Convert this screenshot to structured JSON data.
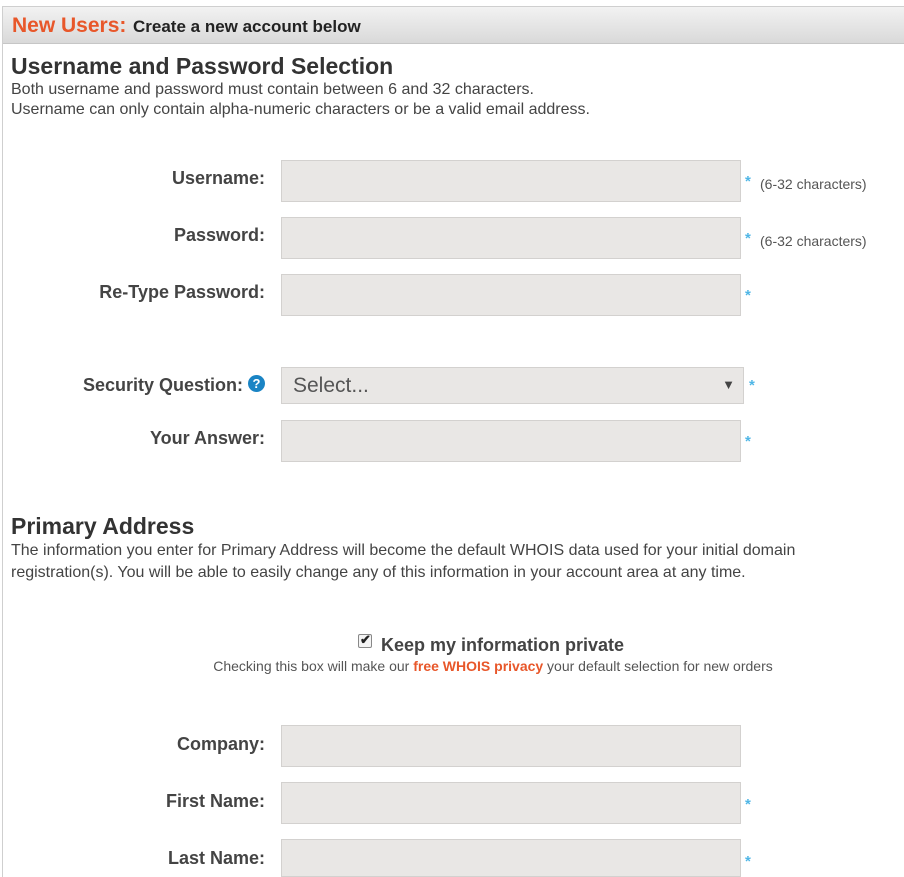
{
  "header": {
    "title": "New Users:",
    "subtitle": "Create a new account below"
  },
  "credentials": {
    "heading": "Username and Password Selection",
    "desc_line1": "Both username and password must contain between 6 and 32 characters.",
    "desc_line2": "Username can only contain alpha-numeric characters or be a valid email address.",
    "username": {
      "label": "Username:",
      "value": "",
      "hint": "(6-32 characters)"
    },
    "password": {
      "label": "Password:",
      "value": "",
      "hint": "(6-32 characters)"
    },
    "retype": {
      "label": "Re-Type Password:",
      "value": ""
    },
    "security_question": {
      "label": "Security Question:",
      "selected": "Select..."
    },
    "answer": {
      "label": "Your Answer:",
      "value": ""
    },
    "required_marker": "*"
  },
  "address": {
    "heading": "Primary Address",
    "desc": "The information you enter for Primary Address will become the default WHOIS data used for your initial domain registration(s). You will be able to easily change any of this information in your account area at any time.",
    "privacy": {
      "checked": true,
      "label": "Keep my information private",
      "note_before": "Checking this box will make our ",
      "note_link": "free WHOIS privacy",
      "note_after": " your default selection for new orders"
    },
    "company": {
      "label": "Company:",
      "value": ""
    },
    "first_name": {
      "label": "First Name:",
      "value": ""
    },
    "last_name": {
      "label": "Last Name:",
      "value": ""
    }
  },
  "icons": {
    "help": "question-circle-icon",
    "dropdown": "caret-down-icon",
    "checkbox": "checkmark-icon"
  },
  "colors": {
    "accent": "#e8572a",
    "required": "#4fb6e6",
    "help_icon": "#1a84c4",
    "field_bg": "#e9e7e5"
  }
}
